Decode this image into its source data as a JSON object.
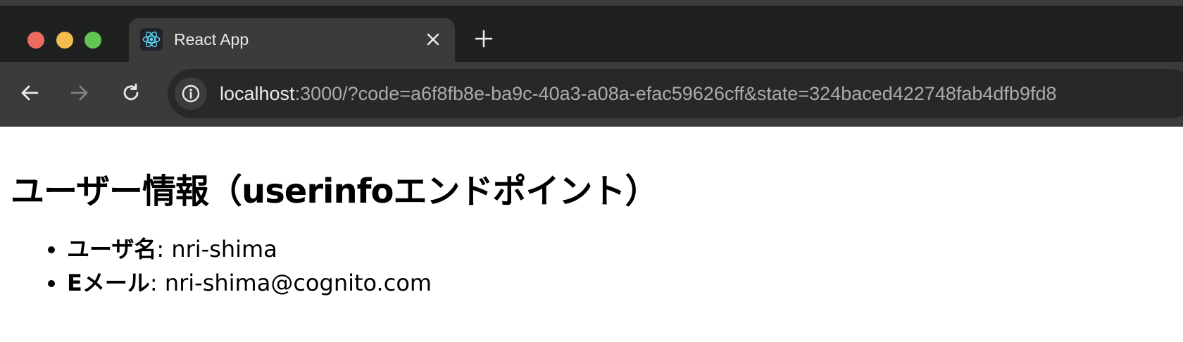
{
  "window": {
    "tab": {
      "title": "React App",
      "favicon": "react-logo-icon",
      "close_icon": "close-icon"
    },
    "new_tab_icon": "plus-icon"
  },
  "toolbar": {
    "back_icon": "arrow-left-icon",
    "forward_icon": "arrow-right-icon",
    "reload_icon": "reload-icon",
    "site_info_icon": "info-icon",
    "url_host": "localhost",
    "url_rest": ":3000/?code=a6f8fb8e-ba9c-40a3-a08a-efac59626cff&state=324baced422748fab4dfb9fd8"
  },
  "page": {
    "title": "ユーザー情報（userinfoエンドポイント）",
    "items": [
      {
        "label": "ユーザ名",
        "sep": ": ",
        "value": "nri-shima"
      },
      {
        "label": "Eメール",
        "sep": ": ",
        "value": "nri-shima@cognito.com"
      }
    ]
  },
  "colors": {
    "tab_bar": "#1f2020",
    "toolbar": "#3b3b3b",
    "red": "#ec6a5e",
    "yellow": "#f4be4f",
    "green": "#61c554",
    "react": "#61dafb"
  }
}
